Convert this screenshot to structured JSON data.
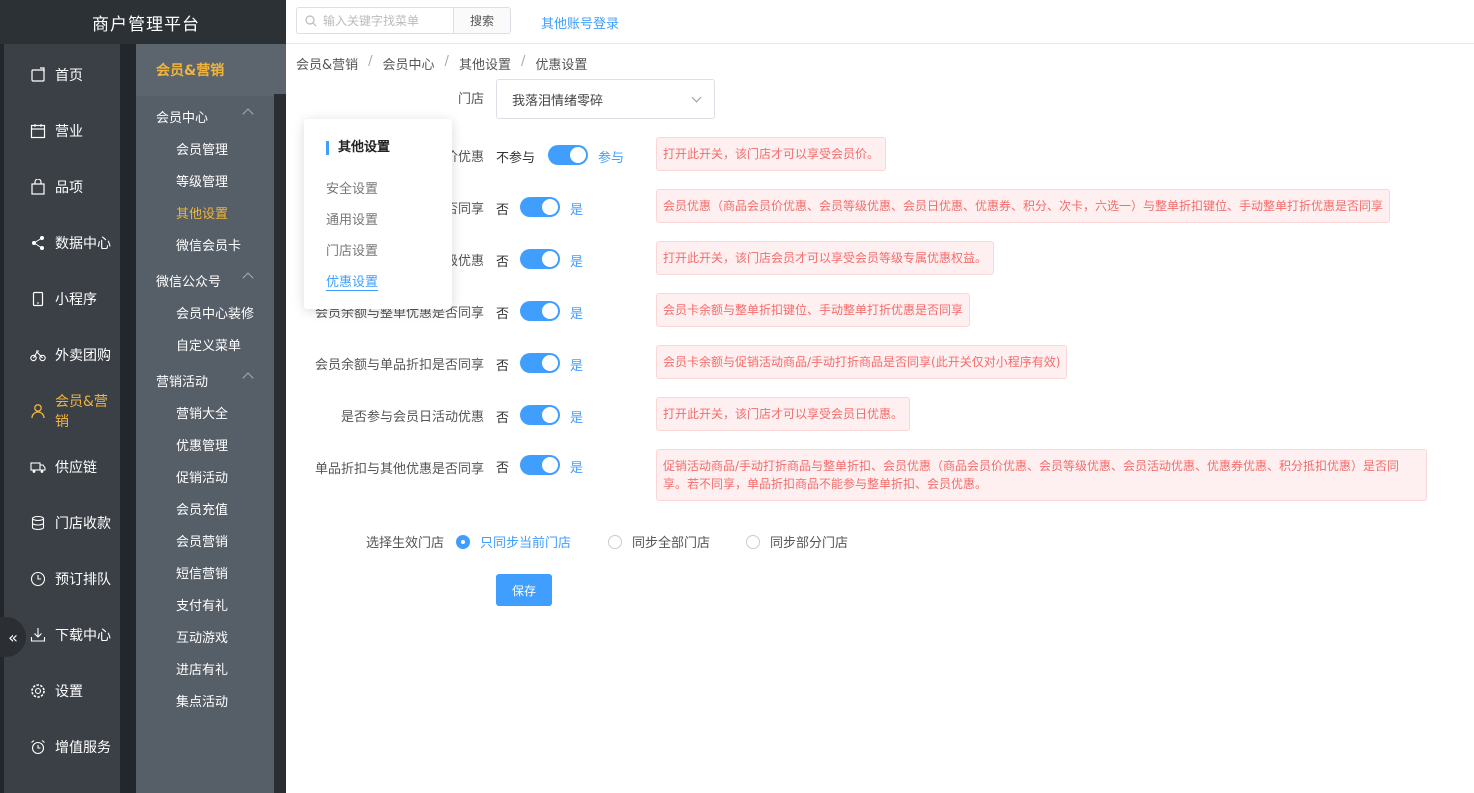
{
  "app": {
    "title": "商户管理平台"
  },
  "topbar": {
    "search_placeholder": "输入关键字找菜单",
    "search_button": "搜索",
    "other_login": "其他账号登录"
  },
  "main_nav": [
    {
      "label": "首页",
      "icon": "home-icon"
    },
    {
      "label": "营业",
      "icon": "calendar-icon"
    },
    {
      "label": "品项",
      "icon": "bag-icon"
    },
    {
      "label": "数据中心",
      "icon": "share-icon"
    },
    {
      "label": "小程序",
      "icon": "phone-icon"
    },
    {
      "label": "外卖团购",
      "icon": "bike-icon"
    },
    {
      "label": "会员&营销",
      "icon": "user-icon",
      "active": true
    },
    {
      "label": "供应链",
      "icon": "truck-icon"
    },
    {
      "label": "门店收款",
      "icon": "database-icon"
    },
    {
      "label": "预订排队",
      "icon": "clock-icon"
    },
    {
      "label": "下载中心",
      "icon": "download-icon"
    },
    {
      "label": "设置",
      "icon": "gear-icon"
    },
    {
      "label": "增值服务",
      "icon": "alarm-icon"
    }
  ],
  "subnav": {
    "heading": "会员&营销",
    "groups": [
      {
        "label": "会员中心",
        "items": [
          "会员管理",
          "等级管理",
          "其他设置",
          "微信会员卡"
        ]
      },
      {
        "label": "微信公众号",
        "items": [
          "会员中心装修",
          "自定义菜单"
        ]
      },
      {
        "label": "营销活动",
        "items": [
          "营销大全",
          "优惠管理",
          "促销活动",
          "会员充值",
          "会员营销",
          "短信营销",
          "支付有礼",
          "互动游戏",
          "进店有礼",
          "集点活动"
        ]
      }
    ],
    "active_item": "其他设置"
  },
  "breadcrumb": [
    "会员&营销",
    "会员中心",
    "其他设置",
    "优惠设置"
  ],
  "popup": {
    "title": "其他设置",
    "items": [
      "安全设置",
      "通用设置",
      "门店设置",
      "优惠设置"
    ],
    "active": "优惠设置"
  },
  "form": {
    "store_label": "门店",
    "store_value": "我落泪情绪零碎",
    "rows": [
      {
        "label": "价优惠",
        "off": "不参与",
        "on": "参与",
        "checked": true,
        "tip": "打开此开关，该门店才可以享受会员价。"
      },
      {
        "label": "否同享",
        "off": "否",
        "on": "是",
        "checked": true,
        "tip": "会员优惠（商品会员价优惠、会员等级优惠、会员日优惠、优惠券、积分、次卡，六选一）与整单折扣键位、手动整单打折优惠是否同享"
      },
      {
        "label": "级优惠",
        "off": "否",
        "on": "是",
        "checked": true,
        "tip": "打开此开关，该门店会员才可以享受会员等级专属优惠权益。"
      },
      {
        "label": "会员余额与整单优惠是否同享",
        "off": "否",
        "on": "是",
        "checked": true,
        "tip": "会员卡余额与整单折扣键位、手动整单打折优惠是否同享"
      },
      {
        "label": "会员余额与单品折扣是否同享",
        "off": "否",
        "on": "是",
        "checked": true,
        "tip": "会员卡余额与促销活动商品/手动打折商品是否同享(此开关仅对小程序有效)"
      },
      {
        "label": "是否参与会员日活动优惠",
        "off": "否",
        "on": "是",
        "checked": true,
        "tip": "打开此开关，该门店才可以享受会员日优惠。"
      },
      {
        "label": "单品折扣与其他优惠是否同享",
        "off": "否",
        "on": "是",
        "checked": true,
        "tip": "促销活动商品/手动打折商品与整单折扣、会员优惠（商品会员价优惠、会员等级优惠、会员活动优惠、优惠券优惠、积分抵扣优惠）是否同享。若不同享，单品折扣商品不能参与整单折扣、会员优惠。"
      }
    ],
    "effective_label": "选择生效门店",
    "radio_options": [
      "只同步当前门店",
      "同步全部门店",
      "同步部分门店"
    ],
    "radio_selected": "只同步当前门店",
    "save_label": "保存"
  },
  "colors": {
    "accent": "#409eff",
    "nav_active": "#f0b53a",
    "tip_text": "#f56c6c"
  }
}
